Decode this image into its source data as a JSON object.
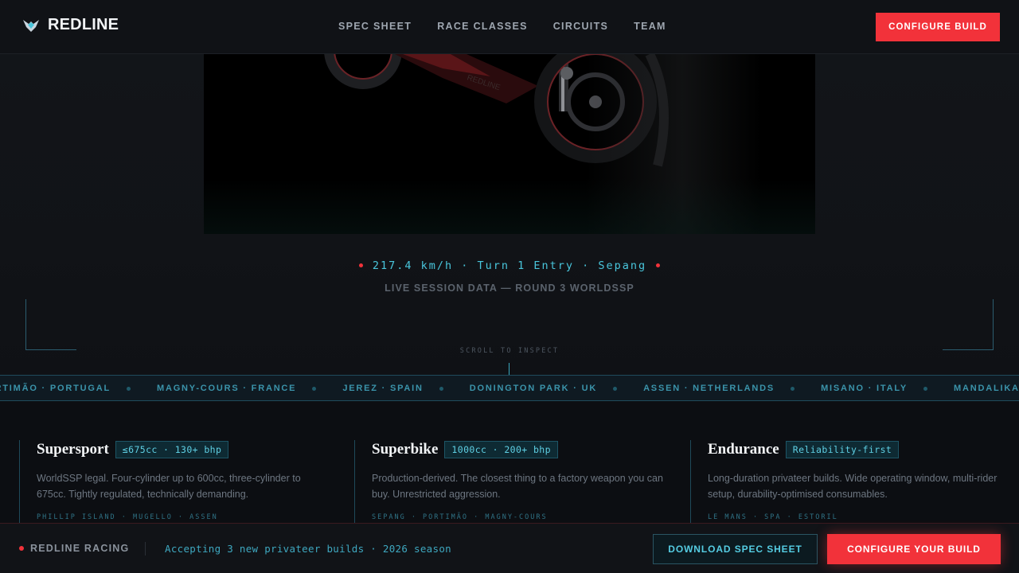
{
  "nav": {
    "brand": "REDLINE",
    "logo_icon": "wing-shield-icon",
    "links": [
      "SPEC SHEET",
      "RACE CLASSES",
      "CIRCUITS",
      "TEAM"
    ],
    "cta": "CONFIGURE BUILD"
  },
  "hero": {
    "telemetry": "217.4 km/h · Turn 1 Entry · Sepang",
    "session": "LIVE SESSION DATA — ROUND 3 WORLDSSP",
    "scroll_hint": "SCROLL TO INSPECT"
  },
  "ticker": {
    "items": [
      "PORTIMÃO · PORTUGAL",
      "MAGNY-COURS · FRANCE",
      "JEREZ · SPAIN",
      "DONINGTON PARK · UK",
      "ASSEN · NETHERLANDS",
      "MISANO · ITALY",
      "MANDALIKA · INDONESIA"
    ]
  },
  "classes": [
    {
      "title": "Supersport",
      "badge": "≤675cc · 130+ bhp",
      "desc": "WorldSSP legal. Four-cylinder up to 600cc, three-cylinder to 675cc. Tightly regulated, technically demanding.",
      "tracks": "PHILLIP ISLAND · MUGELLO · ASSEN"
    },
    {
      "title": "Superbike",
      "badge": "1000cc · 200+ bhp",
      "desc": "Production-derived. The closest thing to a factory weapon you can buy. Unrestricted aggression.",
      "tracks": "SEPANG · PORTIMÃO · MAGNY-COURS"
    },
    {
      "title": "Endurance",
      "badge": "Reliability-first",
      "desc": "Long-duration privateer builds. Wide operating window, multi-rider setup, durability-optimised consumables.",
      "tracks": "LE MANS · SPA · ESTORIL"
    }
  ],
  "footer": {
    "brand": "REDLINE RACING",
    "message": "Accepting 3 new privateer builds · 2026 season",
    "download": "DOWNLOAD SPEC SHEET",
    "configure": "CONFIGURE YOUR BUILD"
  },
  "colors": {
    "accent": "#f2323a",
    "cyan": "#49c6dc",
    "background": "#0d0f13"
  }
}
